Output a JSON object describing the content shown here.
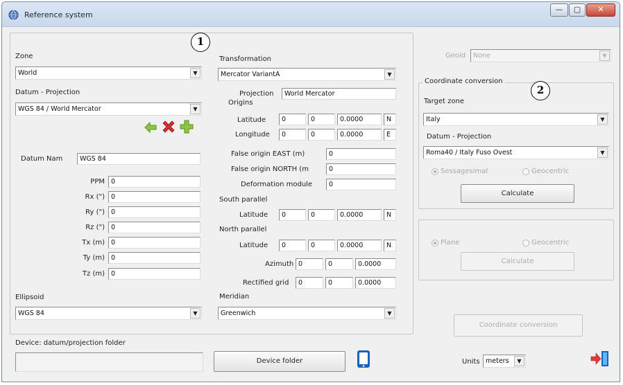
{
  "window": {
    "title": "Reference system",
    "controls": {
      "minimize": "—",
      "maximize": "▢",
      "close": "✕"
    }
  },
  "markers": {
    "one": "1",
    "two": "2"
  },
  "zone": {
    "label": "Zone",
    "value": "World"
  },
  "datum_projection": {
    "label": "Datum - Projection",
    "value": "WGS 84 / World Mercator"
  },
  "datum_params": {
    "datum_name_label": "Datum Nam",
    "datum_name_value": "WGS 84",
    "rows": [
      {
        "label": "PPM",
        "value": "0"
      },
      {
        "label": "Rx (\")",
        "value": "0"
      },
      {
        "label": "Ry (\")",
        "value": "0"
      },
      {
        "label": "Rz (\")",
        "value": "0"
      },
      {
        "label": "Tx (m)",
        "value": "0"
      },
      {
        "label": "Ty (m)",
        "value": "0"
      },
      {
        "label": "Tz (m)",
        "value": "0"
      }
    ]
  },
  "ellipsoid": {
    "label": "Ellipsoid",
    "value": "WGS 84"
  },
  "transformation": {
    "label": "Transformation",
    "value": "Mercator VariantA"
  },
  "projection": {
    "label": "Projection",
    "value": "World Mercator"
  },
  "origins": {
    "label": "Origins",
    "latitude": {
      "label": "Latitude",
      "deg": "0",
      "min": "0",
      "sec": "0.0000",
      "hem": "N"
    },
    "longitude": {
      "label": "Longitude",
      "deg": "0",
      "min": "0",
      "sec": "0.0000",
      "hem": "E"
    }
  },
  "false_origin_east": {
    "label": "False origin EAST (m)",
    "value": "0"
  },
  "false_origin_north": {
    "label": "False origin NORTH (m",
    "value": "0"
  },
  "deformation_module": {
    "label": "Deformation module",
    "value": "0"
  },
  "south_parallel": {
    "label": "South parallel",
    "latitude": {
      "label": "Latitude",
      "deg": "0",
      "min": "0",
      "sec": "0.0000",
      "hem": "N"
    }
  },
  "north_parallel": {
    "label": "North parallel",
    "latitude": {
      "label": "Latitude",
      "deg": "0",
      "min": "0",
      "sec": "0.0000",
      "hem": "N"
    }
  },
  "azimuth": {
    "label": "Azimuth",
    "deg": "0",
    "min": "0",
    "sec": "0.0000"
  },
  "rectified_grid": {
    "label": "Rectified grid",
    "deg": "0",
    "min": "0",
    "sec": "0.0000"
  },
  "meridian": {
    "label": "Meridian",
    "value": "Greenwich"
  },
  "geoid": {
    "label": "Geoid",
    "value": "None"
  },
  "coordinate_conversion": {
    "legend": "Coordinate conversion",
    "target_zone_label": "Target zone",
    "target_zone_value": "Italy",
    "datum_projection_label": "Datum - Projection",
    "datum_projection_value": "Roma40 / Italy Fuso Ovest",
    "radio_sexagesimal": "Sessagesimal",
    "radio_geocentric": "Geocentric",
    "calculate_button": "Calculate"
  },
  "lower_group": {
    "radio_plane": "Plane",
    "radio_geocentric": "Geocentric",
    "calculate_button": "Calculate"
  },
  "coordinate_conversion_button": "Coordinate conversion",
  "device": {
    "label": "Device: datum/projection folder",
    "path_value": "",
    "folder_button": "Device folder"
  },
  "units": {
    "label": "Units",
    "value": "meters"
  },
  "colors": {
    "arrow_left": "#8cc63f",
    "delete_x": "#d32f2f",
    "add_plus": "#8cc63f",
    "device_icon": "#1565c0",
    "exit_icon": "#1565c0",
    "exit_arrow": "#e53935"
  },
  "icons": {
    "title": "globe-icon",
    "back": "arrow-left-icon",
    "delete": "delete-x-icon",
    "add": "add-plus-icon",
    "device": "tablet-device-icon",
    "exit": "exit-door-icon"
  }
}
